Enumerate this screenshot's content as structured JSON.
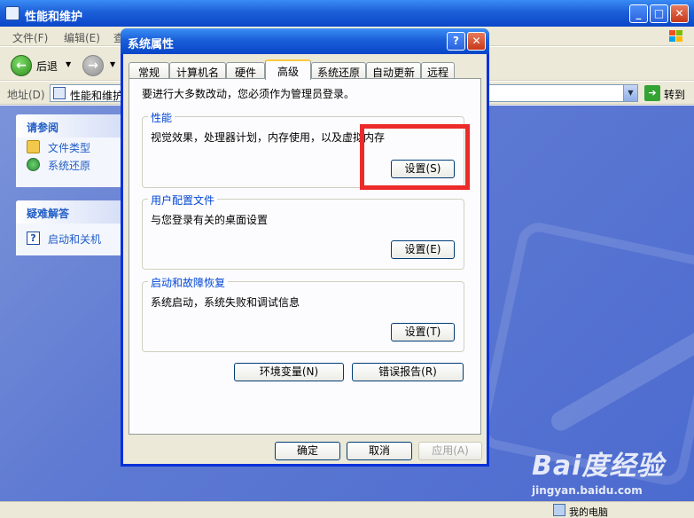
{
  "window": {
    "title": "性能和维护",
    "menu": [
      "文件(F)",
      "编辑(E)",
      "查"
    ],
    "back_label": "后退",
    "address_label": "地址(D)",
    "address_value": "性能和维护",
    "go_label": "转到"
  },
  "sidebar": {
    "see_also": {
      "header": "请参阅",
      "items": [
        {
          "label": "文件类型",
          "icon": "folder-icon"
        },
        {
          "label": "系统还原",
          "icon": "restore-icon"
        }
      ]
    },
    "troubleshoot": {
      "header": "疑难解答",
      "items": [
        {
          "label": "启动和关机",
          "icon": "help-icon"
        }
      ]
    }
  },
  "dialog": {
    "title": "系统属性",
    "tabs": [
      "常规",
      "计算机名",
      "硬件",
      "高级",
      "系统还原",
      "自动更新",
      "远程"
    ],
    "active_tab": "高级",
    "note": "要进行大多数改动，您必须作为管理员登录。",
    "groups": [
      {
        "label": "性能",
        "desc": "视觉效果，处理器计划，内存使用，以及虚拟内存",
        "button": "设置(S)"
      },
      {
        "label": "用户配置文件",
        "desc": "与您登录有关的桌面设置",
        "button": "设置(E)"
      },
      {
        "label": "启动和故障恢复",
        "desc": "系统启动，系统失败和调试信息",
        "button": "设置(T)"
      }
    ],
    "env_button": "环境变量(N)",
    "error_button": "错误报告(R)",
    "ok_button": "确定",
    "cancel_button": "取消",
    "apply_button": "应用(A)"
  },
  "statusbar": {
    "text": "我的电脑"
  },
  "watermark": {
    "brand": "Bai度经验",
    "url": "jingyan.baidu.com"
  },
  "colors": {
    "highlight": "#ec2a2a",
    "xp_blue": "#0a46c9",
    "content_bg": "#5e7ad2"
  }
}
